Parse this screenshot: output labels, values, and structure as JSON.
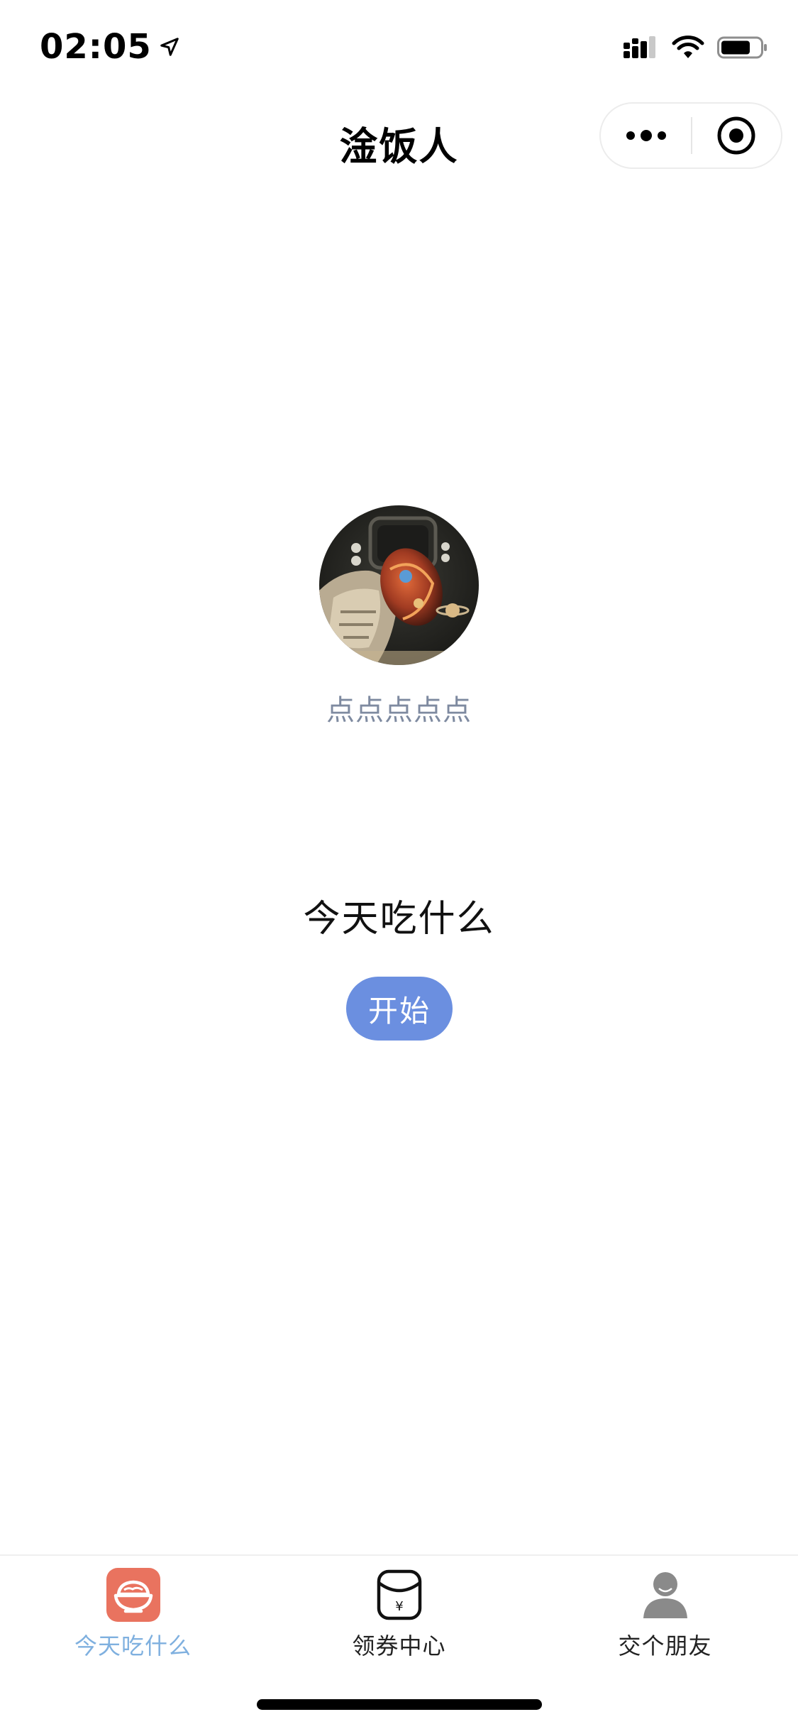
{
  "status_bar": {
    "time": "02:05",
    "icons": [
      "location-arrow-icon",
      "signal-icon",
      "wifi-icon",
      "battery-icon"
    ]
  },
  "nav": {
    "title": "淦饭人",
    "capsule_icons": [
      "more-dots-icon",
      "close-target-icon"
    ]
  },
  "profile": {
    "name": "点点点点点",
    "avatar_icon": "avatar-image"
  },
  "main": {
    "question": "今天吃什么",
    "start_label": "开始"
  },
  "tabbar": {
    "active_color": "#7fb0df",
    "items": [
      {
        "label": "今天吃什么",
        "icon": "rice-bowl-icon",
        "active": true
      },
      {
        "label": "领券中心",
        "icon": "coupon-bag-icon",
        "active": false
      },
      {
        "label": "交个朋友",
        "icon": "person-icon",
        "active": false
      }
    ]
  },
  "colors": {
    "accent_button": "#6b8fe0",
    "tab_active_bg": "#e9735f",
    "name_gray": "#7e8aa0"
  }
}
